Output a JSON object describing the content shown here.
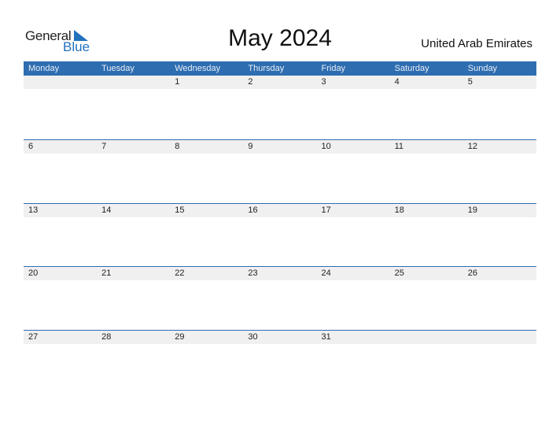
{
  "logo": {
    "word1": "General",
    "word2": "Blue"
  },
  "title": "May 2024",
  "country": "United Arab Emirates",
  "colors": {
    "accent": "#2e6db0",
    "row_bg": "#f0f0f0"
  },
  "weekdays": [
    "Monday",
    "Tuesday",
    "Wednesday",
    "Thursday",
    "Friday",
    "Saturday",
    "Sunday"
  ],
  "weeks": [
    [
      "",
      "",
      "1",
      "2",
      "3",
      "4",
      "5"
    ],
    [
      "6",
      "7",
      "8",
      "9",
      "10",
      "11",
      "12"
    ],
    [
      "13",
      "14",
      "15",
      "16",
      "17",
      "18",
      "19"
    ],
    [
      "20",
      "21",
      "22",
      "23",
      "24",
      "25",
      "26"
    ],
    [
      "27",
      "28",
      "29",
      "30",
      "31",
      "",
      ""
    ]
  ]
}
